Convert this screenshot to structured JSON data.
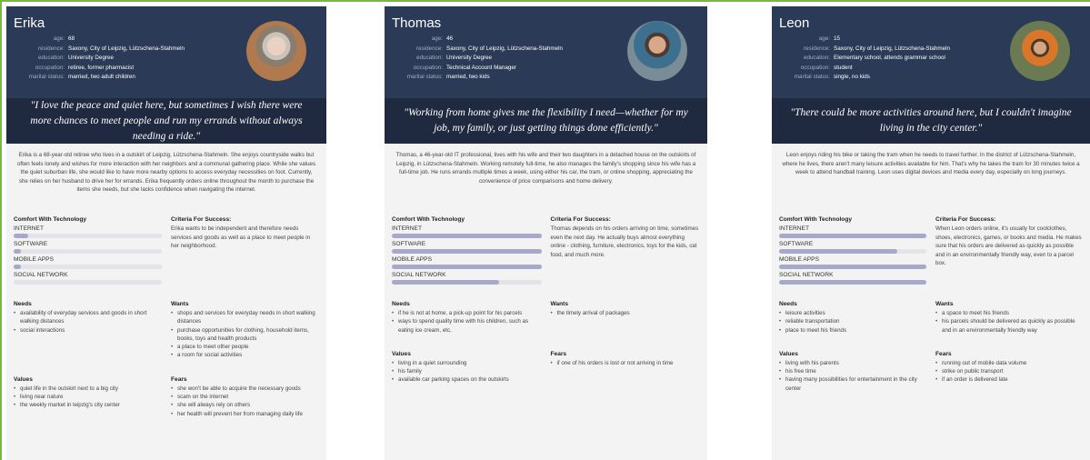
{
  "labels": {
    "age": "age:",
    "residence": "residence:",
    "education": "education:",
    "occupation": "occupation:",
    "marital": "marital status:",
    "comfort": "Comfort With Technology",
    "criteria": "Criteria For Success:",
    "needs": "Needs",
    "wants": "Wants",
    "values": "Values",
    "fears": "Fears",
    "tech": [
      "INTERNET",
      "SOFTWARE",
      "MOBILE APPS",
      "SOCIAL NETWORK"
    ]
  },
  "personas": [
    {
      "name": "Erika",
      "age": "68",
      "residence": "Saxony, City of Leipzig, Lützschena-Stahmeln",
      "education": "University Degree",
      "occupation": "retiree, former pharmacist",
      "marital": "married, two adult children",
      "quote": "\"I love the peace and quiet here, but sometimes I wish there were more chances to meet people and run my errands without always needing a ride.\"",
      "bio": "Erika is a 68-year-old retiree who lives in a outskirt of Leipzig, Lützschena-Stahmeln. She enjoys countryside walks but often feels lonely and wishes for more interaction with her neighbors and a communal gathering place. While she values the quiet suburban life, she would like to have more nearby options to access everyday necessities on foot. Currently, she relies on her husband to drive her for errands. Erika frequently orders online throughout the month to purchase the items she needs, but she lacks confidence when navigating the internet.",
      "tech_levels": [
        0.1,
        0.05,
        0.05,
        0.0
      ],
      "criteria": "Erika wants to be independent and therefore needs services and goods as well as a place to meet people in her neighborhood.",
      "needs": [
        "availability of everyday services and goods in short walking distances",
        "social interactions"
      ],
      "wants": [
        "shops and services for everyday needs in short walking distances",
        "purchase opportunities for clothing, household items, books, toys and health products",
        "a place to meet other people",
        "a room for social activities"
      ],
      "values": [
        "quiet life in the outskirt next to a big city",
        "living near nature",
        "the weekly market in leipzig's city center"
      ],
      "fears": [
        "she won't be able to acquire the necessary goods",
        "scam on the internet",
        "she will always rely on others",
        "her health will prevent her from managing daily life"
      ]
    },
    {
      "name": "Thomas",
      "age": "46",
      "residence": "Saxony, City of Leipzig, Lützschena-Stahmeln",
      "education": "University Degree",
      "occupation": "Technical Account Manager",
      "marital": "married, two kids",
      "quote": "\"Working from home gives me the flexibility I need—whether for my job, my family, or just getting things done efficiently.\"",
      "bio": "Thomas, a 46-year-old IT professional, lives with his wife and their two daughters in a detached house on the outskirts of Leipzig, in Lützschena-Stahmeln. Working remotely full-time, he also manages the family's shopping since his wife has a full-time job. He runs errands multiple times a week, using either his car, the tram, or online shopping, appreciating the convenience of price comparisons and home delivery.",
      "tech_levels": [
        1.0,
        1.0,
        1.0,
        0.72
      ],
      "criteria": "Thomas depends on his orders arriving on time, sometimes even the next day. He actually buys almost everything online - clothing, furniture, electronics, toys for the kids, cat food, and much more.",
      "needs": [
        "if he is not at home, a pick-up point for his parcels",
        "ways to spend quality time with his children, such as eating ice cream, etc."
      ],
      "wants": [
        "the timely arrival of packages"
      ],
      "values": [
        "living in a quiet surrounding",
        "his family",
        "available car parking spaces on the outskirts"
      ],
      "fears": [
        "if one of his orders is lost or not arriving in time"
      ]
    },
    {
      "name": "Leon",
      "age": "15",
      "residence": "Saxony, City of Leipzig, Lützschena-Stahmeln",
      "education": "Elementary school, attends grammar school",
      "occupation": "student",
      "marital": "single, no kids",
      "quote": "\"There could be more activities around here, but I couldn't imagine living in the city center.\"",
      "bio": "Leon enjoys riding his bike or taking the tram when he needs to travel further. In the district of Lützschena-Stahmeln, where he lives, there aren't many leisure activities available for him. That's why he takes the tram for 30 minutes twice a week to attend handball training. Leon uses digital devices and media every day, especially on long journeys.",
      "tech_levels": [
        1.0,
        0.8,
        1.0,
        1.0
      ],
      "criteria": "When Leon orders online, it's usually for coolclothes, shoes, electronics, games, or books and media. He makes sure that his orders are delivered as quickly as possible and in an environmentally friendly way, even to a parcel box.",
      "needs": [
        "leisure activities",
        "reliable transportation",
        "place to meet his friends"
      ],
      "wants": [
        "a space to meet his friends",
        "his parcels should be delivered as quickly as possible and in an environmentally friendly way"
      ],
      "values": [
        "living with his parents",
        "his free time",
        "having many possibilities for entertainment in the city center"
      ],
      "fears": [
        "running out of mobile data volume",
        "strike on public transport",
        "if an order is delivered late"
      ]
    }
  ]
}
